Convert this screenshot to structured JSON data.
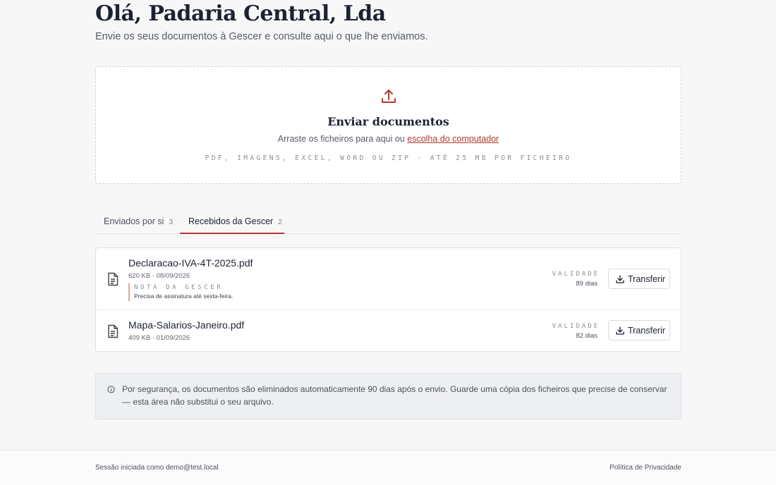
{
  "header": {
    "greeting": "Olá, Padaria Central, Lda",
    "subtitle": "Envie os seus documentos à Gescer e consulte aqui o que lhe enviamos."
  },
  "upload": {
    "icon": "upload-icon",
    "title": "Enviar documentos",
    "prompt": "Arraste os ficheiros para aqui ou",
    "link": "escolha do computador",
    "formats": "PDF, IMAGENS, EXCEL, WORD OU ZIP · ATÉ 25 MB POR FICHEIRO"
  },
  "tabs": [
    {
      "label": "Enviados por si",
      "count": "3",
      "active": false
    },
    {
      "label": "Recebidos da Gescer",
      "count": "2",
      "active": true
    }
  ],
  "documents": [
    {
      "name": "Declaracao-IVA-4T-2025.pdf",
      "meta": "620 KB · 08/09/2026",
      "note_label": "NOTA DA GESCER",
      "note_text": "Precisa de assinatura até sexta-feira.",
      "validade_label": "VALIDADE",
      "validade_value": "89 dias",
      "button": "Transferir"
    },
    {
      "name": "Mapa-Salarios-Janeiro.pdf",
      "meta": "409 KB · 01/09/2026",
      "validade_label": "VALIDADE",
      "validade_value": "82 dias",
      "button": "Transferir"
    }
  ],
  "info": {
    "icon": "info-icon",
    "text": "Por segurança, os documentos são eliminados automaticamente 90 dias após o envio. Guarde uma cópia dos ficheiros que precise de conservar — esta área não substitui o seu arquivo."
  },
  "footer": {
    "session": "Sessão iniciada como demo@test.local",
    "privacy": "Política de Privacidade"
  },
  "colors": {
    "accent": "#b23a2e",
    "background": "#f7f7f8",
    "text": "#1c2231"
  }
}
